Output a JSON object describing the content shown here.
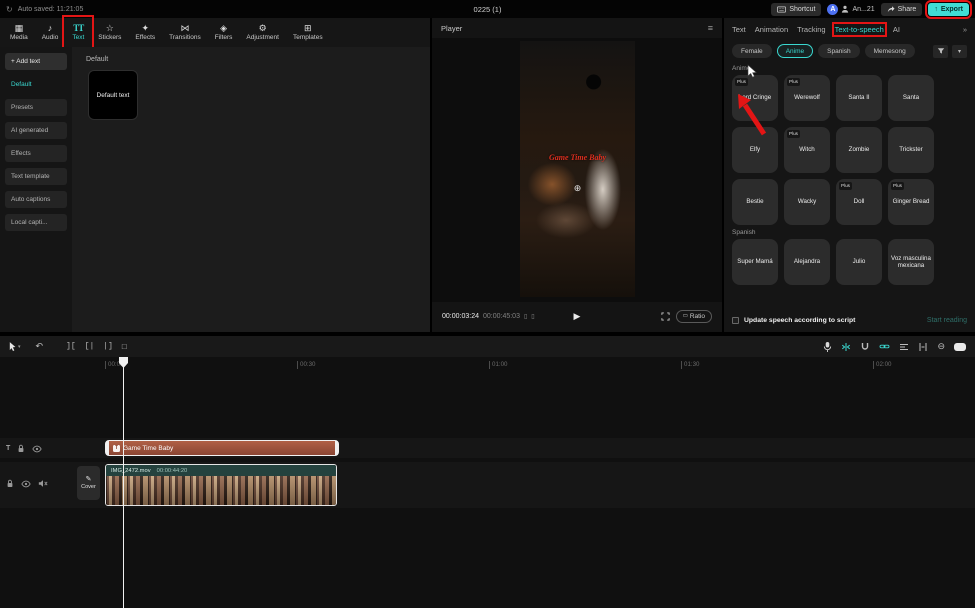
{
  "colors": {
    "accent": "#3ad8d0",
    "annotation_red": "#e31515",
    "export_button": "#41dcd4",
    "text_clip": "#9a4f3b"
  },
  "topbar": {
    "autosave": "Auto saved: 11:21:05",
    "title": "0225 (1)",
    "shortcut_label": "Shortcut",
    "avatar_initial": "A",
    "account_label": "An...21",
    "share_label": "Share",
    "export_label": "Export"
  },
  "ribbon": {
    "items": [
      {
        "label": "Media",
        "icon": "▦"
      },
      {
        "label": "Audio",
        "icon": "♪"
      },
      {
        "label": "Text",
        "icon": "TT",
        "active": true
      },
      {
        "label": "Stickers",
        "icon": "☆"
      },
      {
        "label": "Effects",
        "icon": "✦"
      },
      {
        "label": "Transitions",
        "icon": "⋈"
      },
      {
        "label": "Filters",
        "icon": "◈"
      },
      {
        "label": "Adjustment",
        "icon": "⚙"
      },
      {
        "label": "Templates",
        "icon": "⊞"
      }
    ]
  },
  "sidebar": {
    "items": [
      {
        "label": "+ Add text"
      },
      {
        "label": "Default",
        "active": true
      },
      {
        "label": "Presets"
      },
      {
        "label": "AI generated"
      },
      {
        "label": "Effects"
      },
      {
        "label": "Text template"
      },
      {
        "label": "Auto captions"
      },
      {
        "label": "Local capti..."
      }
    ]
  },
  "text_panel": {
    "heading": "Default",
    "tile_label": "Default text"
  },
  "player": {
    "title": "Player",
    "overlay_text": "Game Time Baby",
    "current_time": "00:00:03:24",
    "duration": "00:00:45:03",
    "ratio_label": "Ratio"
  },
  "tts_panel": {
    "tabs": [
      {
        "label": "Text"
      },
      {
        "label": "Animation"
      },
      {
        "label": "Tracking"
      },
      {
        "label": "Text-to-speech",
        "active": true
      },
      {
        "label": "AI"
      }
    ],
    "more_indicator": "»",
    "chips": [
      {
        "label": "Female"
      },
      {
        "label": "Anime",
        "active": true
      },
      {
        "label": "Spanish"
      },
      {
        "label": "Memesong"
      }
    ],
    "plus_label": "Plus",
    "anime_section": "Anime",
    "anime_voices": [
      {
        "name": "Lord Cringe",
        "plus": true
      },
      {
        "name": "Werewolf",
        "plus": true
      },
      {
        "name": "Santa II",
        "plus": false
      },
      {
        "name": "Santa",
        "plus": false
      },
      {
        "name": "Elfy",
        "plus": false
      },
      {
        "name": "Witch",
        "plus": true
      },
      {
        "name": "Zombie",
        "plus": false
      },
      {
        "name": "Trickster",
        "plus": false
      },
      {
        "name": "Bestie",
        "plus": false
      },
      {
        "name": "Wacky",
        "plus": false
      },
      {
        "name": "Doll",
        "plus": true
      },
      {
        "name": "Ginger Bread",
        "plus": true
      }
    ],
    "spanish_section": "Spanish",
    "spanish_voices": [
      {
        "name": "Super Mamá",
        "plus": false
      },
      {
        "name": "Alejandra",
        "plus": false
      },
      {
        "name": "Julio",
        "plus": false
      },
      {
        "name": "Voz masculina mexicana",
        "plus": false
      }
    ],
    "footer": {
      "checkbox_label": "Update speech according to script",
      "start_button": "Start reading"
    }
  },
  "timeline": {
    "ruler": [
      "00:00",
      "00:30",
      "01:00",
      "01:30",
      "02:00"
    ],
    "text_clip": {
      "label": "Game Time Baby"
    },
    "video_clip": {
      "name": "IMG_2472.mov",
      "duration": "00:00:44:20"
    },
    "cover_label": "Cover"
  }
}
